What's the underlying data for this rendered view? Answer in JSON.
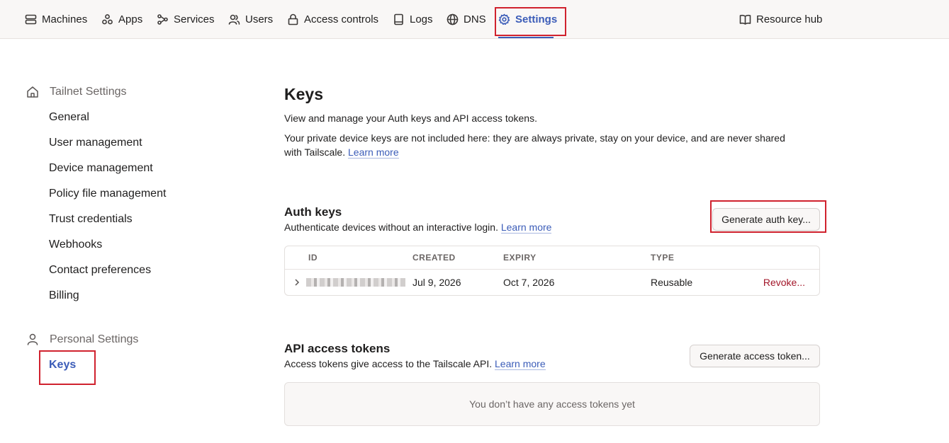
{
  "nav": {
    "items": [
      {
        "label": "Machines",
        "icon": "machines-icon"
      },
      {
        "label": "Apps",
        "icon": "apps-icon"
      },
      {
        "label": "Services",
        "icon": "services-icon"
      },
      {
        "label": "Users",
        "icon": "users-icon"
      },
      {
        "label": "Access controls",
        "icon": "lock-icon"
      },
      {
        "label": "Logs",
        "icon": "logs-icon"
      },
      {
        "label": "DNS",
        "icon": "globe-icon"
      },
      {
        "label": "Settings",
        "icon": "gear-icon",
        "active": true
      }
    ],
    "resource_hub": "Resource hub"
  },
  "sidebar": {
    "tailnet_heading": "Tailnet Settings",
    "tailnet_items": [
      "General",
      "User management",
      "Device management",
      "Policy file management",
      "Trust credentials",
      "Webhooks",
      "Contact preferences",
      "Billing"
    ],
    "personal_heading": "Personal Settings",
    "personal_items": [
      "Keys"
    ]
  },
  "main": {
    "title": "Keys",
    "desc1": "View and manage your Auth keys and API access tokens.",
    "desc2_line1": "Your private device keys are not included here: they are always private, stay on your device, and are never shared",
    "desc2_line2": "with Tailscale.",
    "learn_more": "Learn more",
    "auth": {
      "title": "Auth keys",
      "desc": "Authenticate devices without an interactive login.",
      "learn_more": "Learn more",
      "button": "Generate auth key...",
      "columns": [
        "ID",
        "CREATED",
        "EXPIRY",
        "TYPE"
      ],
      "rows": [
        {
          "created": "Jul 9, 2026",
          "expiry": "Oct 7, 2026",
          "type": "Reusable",
          "action": "Revoke..."
        }
      ]
    },
    "api": {
      "title": "API access tokens",
      "desc": "Access tokens give access to the Tailscale API.",
      "learn_more": "Learn more",
      "button": "Generate access token...",
      "empty": "You don’t have any access tokens yet"
    }
  },
  "colors": {
    "accent": "#3b5cb8",
    "danger": "#a3172a",
    "highlight": "#d0222e",
    "nav_bg": "#f9f7f6"
  }
}
